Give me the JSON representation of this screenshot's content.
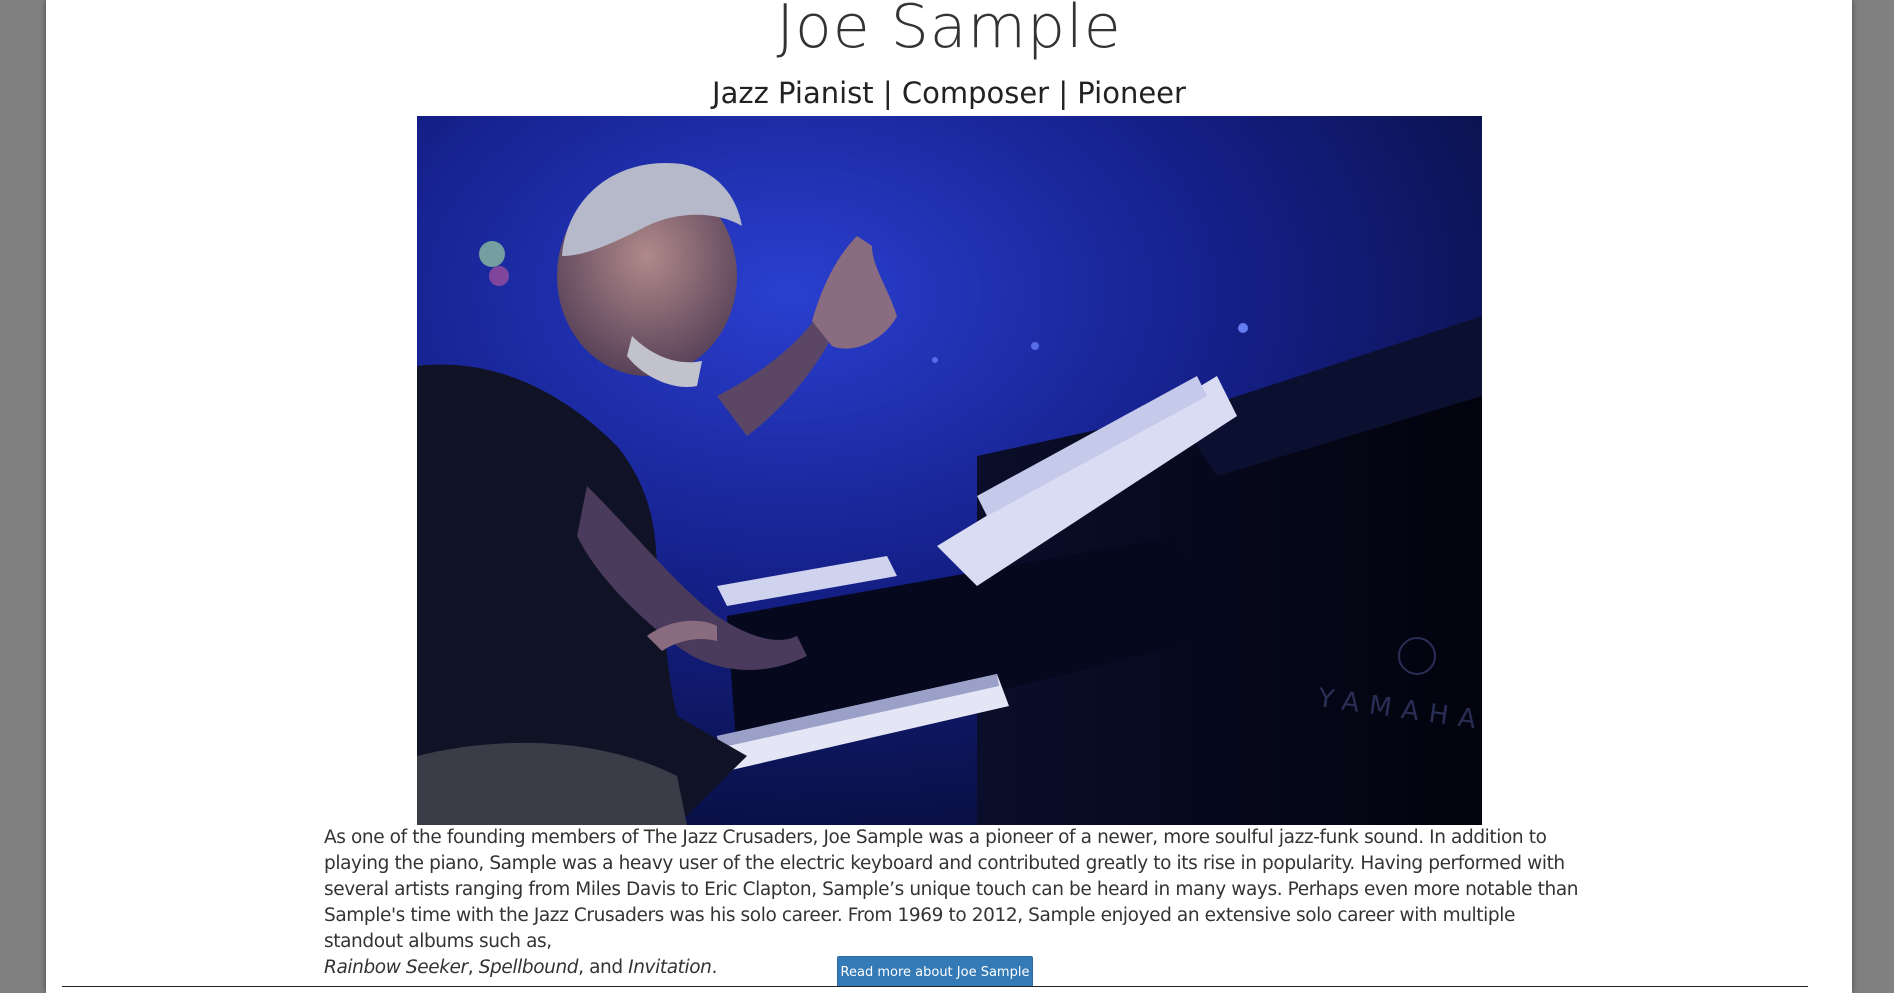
{
  "header": {
    "title": "Joe Sample",
    "subtitle": "Jazz Pianist | Composer | Pioneer"
  },
  "bio": {
    "text": "As one of the founding members of The Jazz Crusaders, Joe Sample was a pioneer of a newer, more soulful jazz-funk sound. In addition to playing the piano, Sample was a heavy user of the electric keyboard and contributed greatly to its rise in popularity. Having performed with several artists ranging from Miles Davis to Eric Clapton, Sample’s unique touch can be heard in many ways. Perhaps even more notable than Sample's time with the Jazz Crusaders was his solo career. From 1969 to 2012, Sample enjoyed an extensive solo career with multiple standout albums such as,",
    "album_1": "Rainbow Seeker",
    "sep_1": ", ",
    "album_2": "Spellbound",
    "sep_2": ", and ",
    "album_3": "Invitation",
    "end": "."
  },
  "actions": {
    "read_more_label": "Read more about Joe Sample"
  },
  "photo": {
    "piano_brand": "YAMAHA"
  },
  "colors": {
    "background": "#808080",
    "page": "#ffffff",
    "button": "#337ab7",
    "text": "#333333"
  }
}
